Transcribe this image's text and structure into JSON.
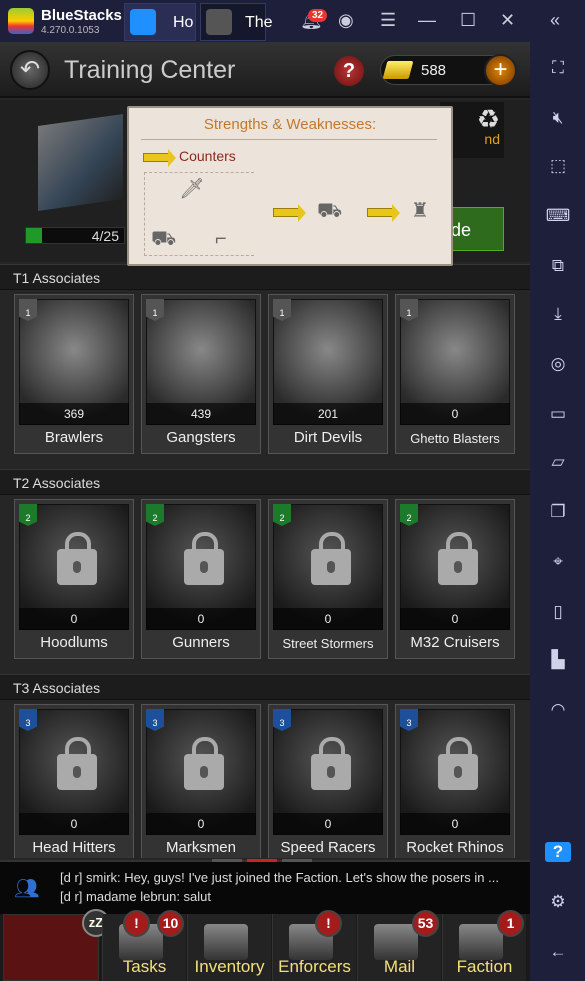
{
  "window": {
    "brand": "BlueStacks",
    "version": "4.270.0.1053",
    "tabs": [
      {
        "label": "Ho",
        "icon": "home-icon"
      },
      {
        "label": "The",
        "icon": "game-icon"
      }
    ],
    "notifications": "32"
  },
  "header": {
    "title": "Training Center",
    "gold": "588"
  },
  "building": {
    "progress_text": "4/25",
    "progress": 0.16,
    "upgrade_label": "de",
    "refresh_label": "nd"
  },
  "popup": {
    "title": "Strengths & Weaknesses:",
    "legend": "Counters"
  },
  "sections": [
    {
      "title": "T1 Associates",
      "tier": "1",
      "color": "#555",
      "units": [
        {
          "name": "Brawlers",
          "count": "369"
        },
        {
          "name": "Gangsters",
          "count": "439"
        },
        {
          "name": "Dirt Devils",
          "count": "201"
        },
        {
          "name": "Ghetto Blasters",
          "count": "0"
        }
      ],
      "locked": false
    },
    {
      "title": "T2 Associates",
      "tier": "2",
      "color": "#1d7a2a",
      "units": [
        {
          "name": "Hoodlums",
          "count": "0"
        },
        {
          "name": "Gunners",
          "count": "0"
        },
        {
          "name": "Street Stormers",
          "count": "0"
        },
        {
          "name": "M32 Cruisers",
          "count": "0"
        }
      ],
      "locked": true
    },
    {
      "title": "T3 Associates",
      "tier": "3",
      "color": "#1d4f9a",
      "units": [
        {
          "name": "Head Hitters",
          "count": "0"
        },
        {
          "name": "Marksmen",
          "count": "0"
        },
        {
          "name": "Speed Racers",
          "count": "0"
        },
        {
          "name": "Rocket Rhinos",
          "count": "0"
        }
      ],
      "locked": true
    }
  ],
  "chat": [
    "[d r] smirk: Hey, guys! I've just joined the Faction. Let's show the posers in ...",
    "[d r] madame lebrun: salut"
  ],
  "bottom": [
    {
      "label": "Tasks",
      "alert": true,
      "badge": "10"
    },
    {
      "label": "Inventory"
    },
    {
      "label": "Enforcers",
      "alert": true
    },
    {
      "label": "Mail",
      "badge": "53"
    },
    {
      "label": "Faction",
      "badge": "1"
    }
  ]
}
